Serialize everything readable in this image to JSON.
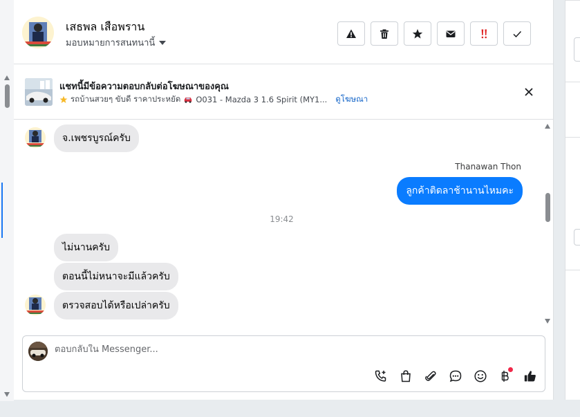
{
  "header": {
    "contact_name": "เสธพล เสือพราน",
    "assign_label": "มอบหมายการสนทนานี้",
    "actions": [
      {
        "name": "report-button",
        "icon": "warning-icon"
      },
      {
        "name": "delete-button",
        "icon": "trash-icon"
      },
      {
        "name": "star-button",
        "icon": "star-icon"
      },
      {
        "name": "mark-unread-button",
        "icon": "envelope-icon"
      },
      {
        "name": "follow-up-button",
        "icon": "double-exclamation-icon"
      },
      {
        "name": "mark-done-button",
        "icon": "check-icon"
      }
    ]
  },
  "ad_banner": {
    "title": "แชทนี้มีข้อความตอบกลับต่อโฆษณาของคุณ",
    "subtitle_part1": "รถบ้านสวยๆ ขับดี ราคาประหยัด",
    "subtitle_part2": "O031 - Mazda 3 1.6 Spirit (MY1...",
    "link": "ดูโฆษณา"
  },
  "conversation": {
    "messages": [
      {
        "direction": "incoming",
        "text": "จ.เพชรบูรณ์ครับ"
      },
      {
        "direction": "outgoing",
        "sender": "Thanawan Thon",
        "text": "ลูกค้าติดลาช้านานไหมคะ"
      },
      {
        "direction": "incoming",
        "text": "ไม่นานครับ"
      },
      {
        "direction": "incoming",
        "text": "ตอนนี้ไม่หนาจะมีแล้วครับ"
      },
      {
        "direction": "incoming",
        "text": "ตรวจสอบได้หรือเปล่าครับ"
      }
    ],
    "timestamp": "19:42"
  },
  "composer": {
    "placeholder": "ตอบกลับใน Messenger...",
    "tools": [
      "phone-plus-icon",
      "shopping-bag-icon",
      "paperclip-icon",
      "saved-reply-icon",
      "emoji-icon",
      "baht-icon",
      "thumbs-up-icon"
    ]
  },
  "colors": {
    "accent": "#0a7cff",
    "incoming_bubble": "#e9e9eb",
    "link": "#1264c8",
    "follow_up_red": "#e02424"
  }
}
